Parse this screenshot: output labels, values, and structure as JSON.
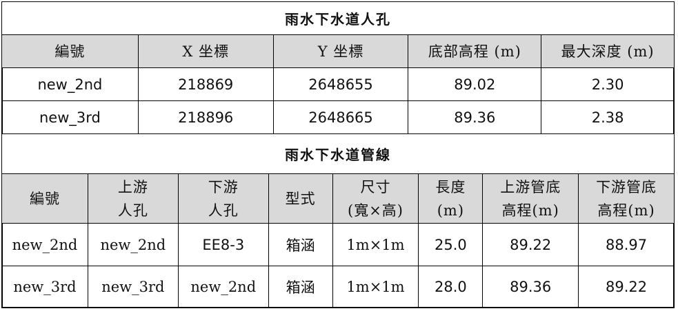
{
  "manhole_section": {
    "title": "雨水下水道人孔",
    "headers": [
      "編號",
      "X 坐標",
      "Y 坐標",
      "底部高程 (m)",
      "最大深度 (m)"
    ],
    "rows": [
      [
        "new_2nd",
        "218869",
        "2648655",
        "89.02",
        "2.30"
      ],
      [
        "new_3rd",
        "218896",
        "2648665",
        "89.36",
        "2.38"
      ]
    ]
  },
  "pipe_section": {
    "title": "雨水下水道管線",
    "headers": [
      {
        "line1": "編號",
        "line2": ""
      },
      {
        "line1": "上游",
        "line2": "人孔"
      },
      {
        "line1": "下游",
        "line2": "人孔"
      },
      {
        "line1": "型式",
        "line2": ""
      },
      {
        "line1": "尺寸",
        "line2": "(寬×高)"
      },
      {
        "line1": "長度",
        "line2": "(m)"
      },
      {
        "line1": "上游管底",
        "line2": "高程(m)"
      },
      {
        "line1": "下游管底",
        "line2": "高程(m)"
      }
    ],
    "rows": [
      [
        "new_2nd",
        "new_2nd",
        "EE8-3",
        "箱涵",
        "1m×1m",
        "25.0",
        "89.22",
        "88.97"
      ],
      [
        "new_3rd",
        "new_3rd",
        "new_2nd",
        "箱涵",
        "1m×1m",
        "28.0",
        "89.36",
        "89.22"
      ]
    ]
  }
}
